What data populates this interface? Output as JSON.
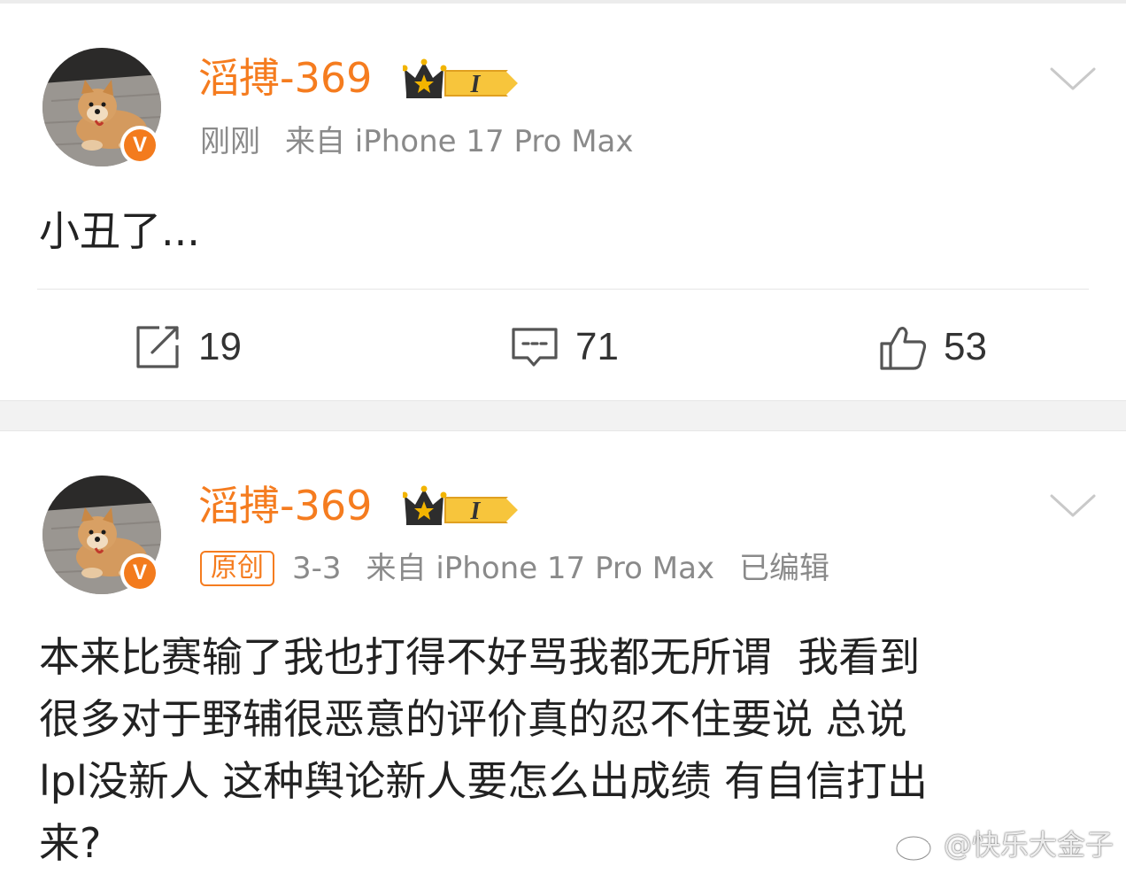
{
  "post1": {
    "username": "滔搏-369",
    "level": "I",
    "time": "刚刚",
    "source": "来自 iPhone 17 Pro Max",
    "text": "小丑了...",
    "actions": {
      "repost_count": "19",
      "comment_count": "71",
      "like_count": "53"
    }
  },
  "post2": {
    "username": "滔搏-369",
    "level": "I",
    "tag": "原创",
    "time": "3-3",
    "source": "来自 iPhone 17 Pro Max",
    "edited": "已编辑",
    "lines": [
      "本来比赛输了我也打得不好骂我都无所谓  我看到",
      "很多对于野辅很恶意的评价真的忍不住要说 总说",
      "lpl没新人 这种舆论新人要怎么出成绩 有自信打出",
      "来?"
    ]
  },
  "watermark": "@快乐大金子",
  "colors": {
    "accent": "#f57c1f",
    "meta": "#8a8a8a",
    "text": "#222222"
  },
  "icons": [
    "repost-icon",
    "comment-icon",
    "like-icon",
    "chevron-down-icon",
    "verified-badge-icon",
    "crown-icon"
  ]
}
